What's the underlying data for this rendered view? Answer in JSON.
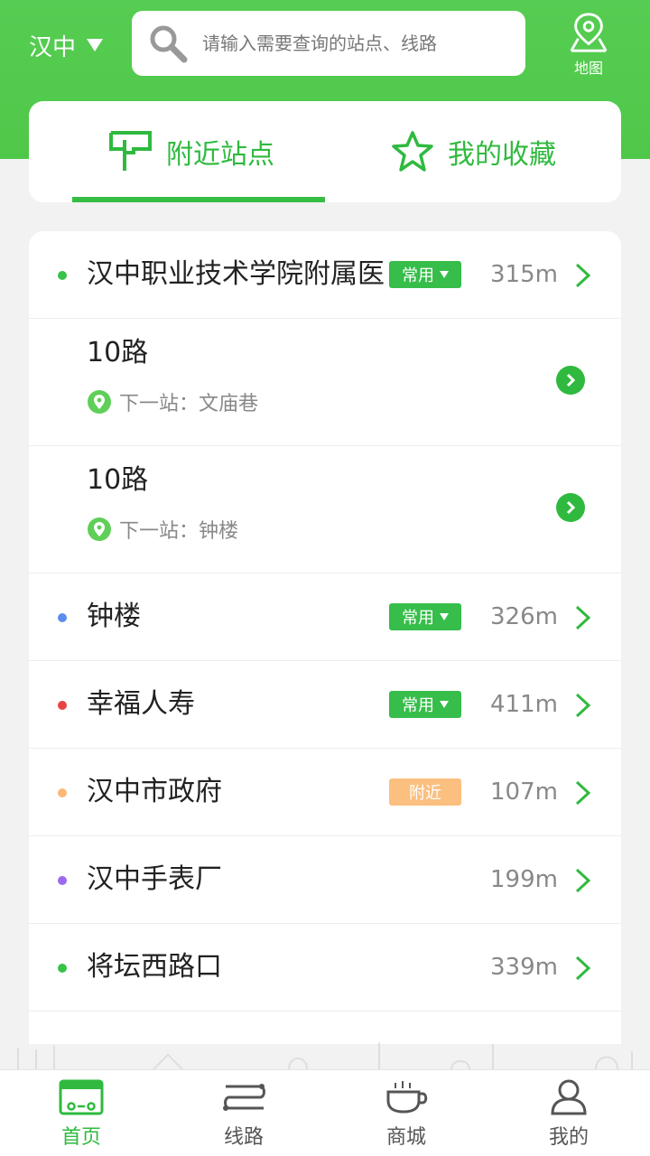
{
  "header": {
    "city": "汉中",
    "search_placeholder": "请输入需要查询的站点、线路",
    "map_label": "地图"
  },
  "tabs": [
    {
      "label": "附近站点",
      "active": true,
      "icon": "stop-sign-icon"
    },
    {
      "label": "我的收藏",
      "active": false,
      "icon": "star-icon"
    }
  ],
  "stations": {
    "s1": {
      "name": "汉中职业技术学院附属医",
      "tag": "常用",
      "distance": "315m",
      "dot_color": "#37c24a"
    },
    "lines": [
      {
        "name": "10路",
        "next_label": "下一站：文庙巷"
      },
      {
        "name": "10路",
        "next_label": "下一站：钟楼"
      }
    ],
    "s2": {
      "name": "钟楼",
      "tag": "常用",
      "distance": "326m",
      "dot_color": "#5b8def"
    },
    "s3": {
      "name": "幸福人寿",
      "tag": "常用",
      "distance": "411m",
      "dot_color": "#e94343"
    },
    "s4": {
      "name": "汉中市政府",
      "tag": "附近",
      "distance": "107m",
      "dot_color": "#fbb774"
    },
    "s5": {
      "name": "汉中手表厂",
      "distance": "199m",
      "dot_color": "#9a6bef"
    },
    "s6": {
      "name": "将坛西路口",
      "distance": "339m",
      "dot_color": "#37c24a"
    }
  },
  "nav": [
    {
      "label": "首页",
      "icon": "bus-icon",
      "active": true
    },
    {
      "label": "线路",
      "icon": "route-icon",
      "active": false
    },
    {
      "label": "商城",
      "icon": "cup-icon",
      "active": false
    },
    {
      "label": "我的",
      "icon": "user-icon",
      "active": false
    }
  ],
  "colors": {
    "brand": "#4fc84a",
    "accent": "#2fba3f",
    "orange_tag": "#fbbf7f"
  }
}
